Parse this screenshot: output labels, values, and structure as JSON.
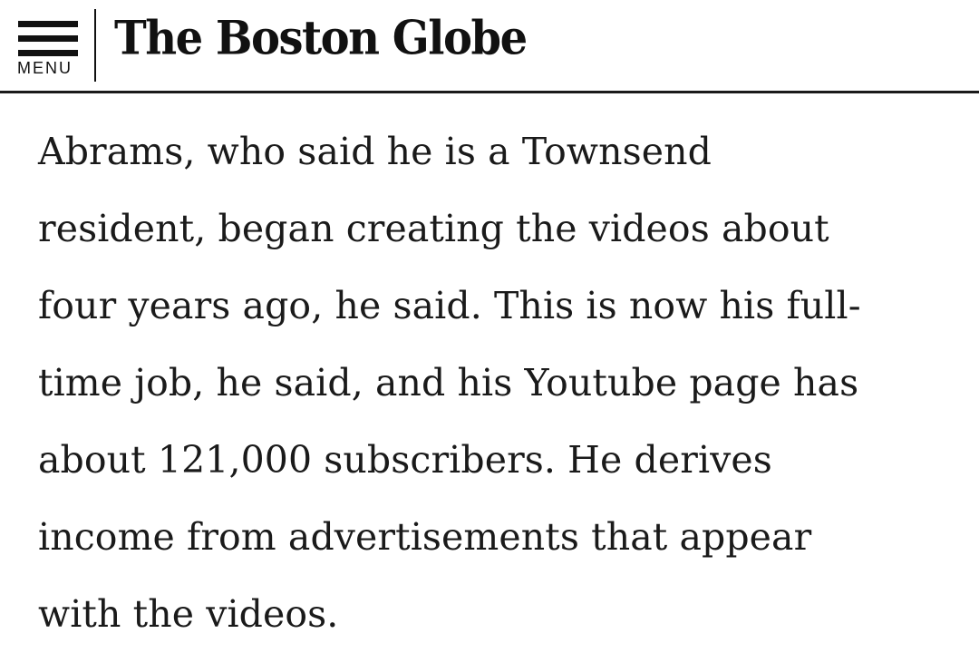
{
  "header": {
    "menu_label": "MENU",
    "logo_text": "The Boston Globe"
  },
  "article": {
    "paragraph_lines": [
      "Abrams, who said he is a Townsend",
      "resident, began creating the videos about",
      "four years ago, he said. This is now his full-",
      "time job, he said, and his Youtube page has",
      "about 121,000 subscribers. He derives",
      "income from advertisements that appear",
      "with the videos."
    ]
  }
}
